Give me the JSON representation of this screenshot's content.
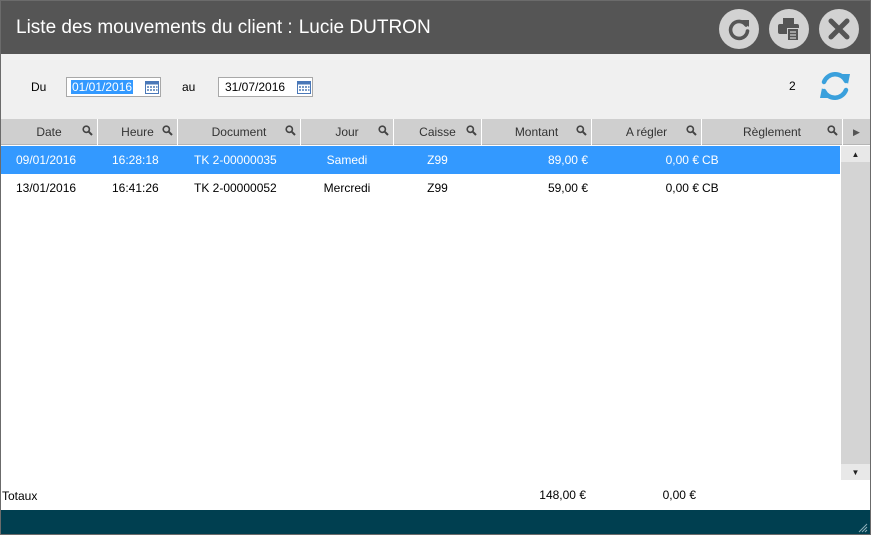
{
  "window": {
    "title": "Liste des mouvements du client :",
    "client_name": "Lucie DUTRON"
  },
  "toolbar": {
    "buttons": [
      "refresh-icon",
      "print-icon",
      "close-icon"
    ]
  },
  "filter": {
    "from_label": "Du",
    "from_value": "01/01/2016",
    "to_label": "au",
    "to_value": "31/07/2016",
    "count": "2"
  },
  "columns": [
    "Date",
    "Heure",
    "Document",
    "Jour",
    "Caisse",
    "Montant",
    "A régler",
    "Règlement"
  ],
  "rows": [
    {
      "date": "09/01/2016",
      "heure": "16:28:18",
      "document": "TK 2-00000035",
      "jour": "Samedi",
      "caisse": "Z99",
      "montant": "89,00 €",
      "a_regler": "0,00 €",
      "reglement": "CB",
      "selected": true
    },
    {
      "date": "13/01/2016",
      "heure": "16:41:26",
      "document": "TK 2-00000052",
      "jour": "Mercredi",
      "caisse": "Z99",
      "montant": "59,00 €",
      "a_regler": "0,00 €",
      "reglement": "CB",
      "selected": false
    }
  ],
  "totals": {
    "label": "Totaux",
    "montant": "148,00 €",
    "a_regler": "0,00 €"
  },
  "colors": {
    "titlebar": "#555555",
    "selection": "#3399ff",
    "footer": "#003f50",
    "refresh_accent": "#3aa0dc"
  }
}
